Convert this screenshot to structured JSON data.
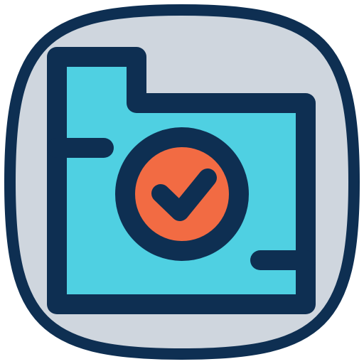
{
  "icon": {
    "name": "folder-check-icon",
    "colors": {
      "outline": "#0E2F52",
      "tile": "#CFD6DE",
      "folder": "#4FD0E2",
      "badge": "#F26B43",
      "background": "#FFFFFF"
    }
  }
}
